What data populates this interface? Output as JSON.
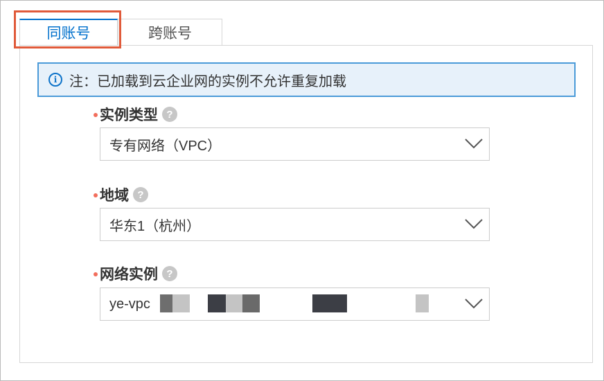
{
  "tabs": {
    "same_account": "同账号",
    "cross_account": "跨账号"
  },
  "notice": {
    "icon": "info-icon",
    "text": "注：已加载到云企业网的实例不允许重复加载"
  },
  "fields": {
    "instance_type": {
      "label": "实例类型",
      "help": "?",
      "value": "专有网络（VPC）"
    },
    "region": {
      "label": "地域",
      "help": "?",
      "value": "华东1（杭州）"
    },
    "network_instance": {
      "label": "网络实例",
      "help": "?",
      "value": "ye-vpc"
    }
  },
  "colors": {
    "accent": "#0070cc",
    "highlight": "#e05a3a",
    "required": "#f26d5b",
    "notice_bg": "#e7f1fa",
    "notice_border": "#4a9ad8"
  }
}
